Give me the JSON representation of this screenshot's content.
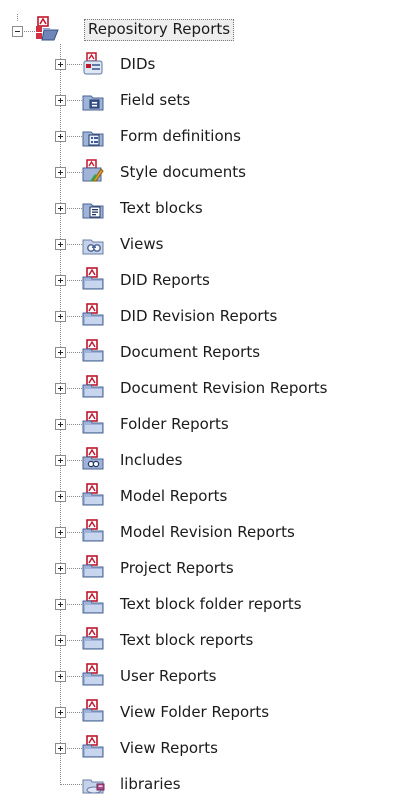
{
  "tree": {
    "root": {
      "label": "Repository Reports",
      "icon": "repository-reports-icon",
      "expanded": true
    },
    "children": [
      {
        "label": "DIDs",
        "icon": "dids-icon",
        "kind": "did"
      },
      {
        "label": "Field sets",
        "icon": "field-sets-icon",
        "kind": "fieldset"
      },
      {
        "label": "Form definitions",
        "icon": "form-definitions-icon",
        "kind": "form"
      },
      {
        "label": "Style documents",
        "icon": "style-documents-icon",
        "kind": "style"
      },
      {
        "label": "Text blocks",
        "icon": "text-blocks-icon",
        "kind": "textblock"
      },
      {
        "label": "Views",
        "icon": "views-icon",
        "kind": "views"
      },
      {
        "label": "DID Reports",
        "icon": "report-icon",
        "kind": "report"
      },
      {
        "label": "DID Revision Reports",
        "icon": "report-icon",
        "kind": "report"
      },
      {
        "label": "Document Reports",
        "icon": "report-icon",
        "kind": "report"
      },
      {
        "label": "Document Revision Reports",
        "icon": "report-icon",
        "kind": "report"
      },
      {
        "label": "Folder Reports",
        "icon": "report-icon",
        "kind": "report"
      },
      {
        "label": "Includes",
        "icon": "includes-icon",
        "kind": "includes"
      },
      {
        "label": "Model Reports",
        "icon": "report-icon",
        "kind": "report"
      },
      {
        "label": "Model Revision Reports",
        "icon": "report-icon",
        "kind": "report"
      },
      {
        "label": "Project Reports",
        "icon": "report-icon",
        "kind": "report"
      },
      {
        "label": "Text block folder reports",
        "icon": "report-icon",
        "kind": "report"
      },
      {
        "label": "Text block reports",
        "icon": "report-icon",
        "kind": "report"
      },
      {
        "label": "User Reports",
        "icon": "report-icon",
        "kind": "report"
      },
      {
        "label": "View Folder Reports",
        "icon": "report-icon",
        "kind": "report"
      },
      {
        "label": "View Reports",
        "icon": "report-icon",
        "kind": "report"
      }
    ],
    "last": {
      "label": "libraries",
      "icon": "libraries-icon",
      "kind": "libraries"
    }
  }
}
